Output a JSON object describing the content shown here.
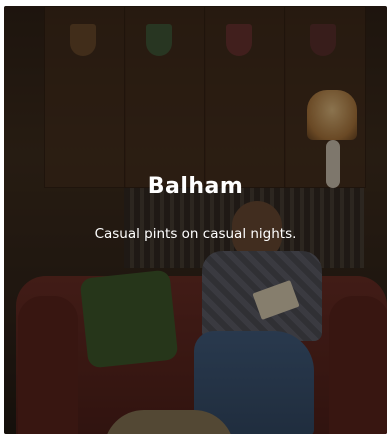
{
  "card": {
    "title": "Balham",
    "subtitle": "Casual pints on casual nights."
  },
  "colors": {
    "text": "#ffffff",
    "overlay": "#0f0a06"
  }
}
